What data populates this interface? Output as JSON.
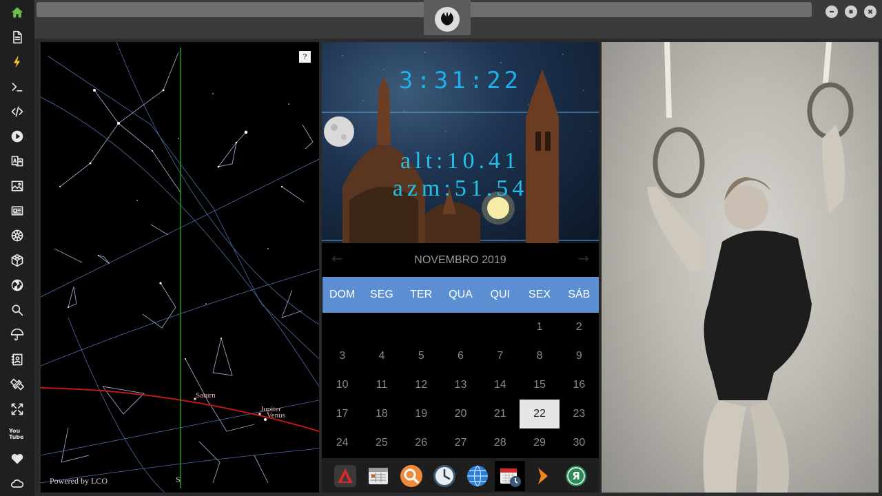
{
  "sidebar": {
    "items": [
      {
        "icon": "home-icon",
        "active_color": "#6abf4b"
      },
      {
        "icon": "document-icon"
      },
      {
        "icon": "lightning-icon",
        "active_color": "#f1c232"
      },
      {
        "icon": "terminal-icon"
      },
      {
        "icon": "code-icon"
      },
      {
        "icon": "play-icon"
      },
      {
        "icon": "translate-icon"
      },
      {
        "icon": "image-icon"
      },
      {
        "icon": "news-icon"
      },
      {
        "icon": "galactic-empire-icon"
      },
      {
        "icon": "hexagon-icon"
      },
      {
        "icon": "globe-icon"
      },
      {
        "icon": "search-icon"
      },
      {
        "icon": "umbrella-icon"
      },
      {
        "icon": "contacts-icon"
      },
      {
        "icon": "link-icon"
      },
      {
        "icon": "expand-icon"
      },
      {
        "icon": "youtube-icon",
        "label": "You Tube"
      },
      {
        "icon": "heart-icon"
      },
      {
        "icon": "cloud-icon"
      }
    ]
  },
  "sky": {
    "help": "?",
    "credit": "Powered by LCO",
    "direction": "S",
    "planets": [
      "Saturn",
      "Jupiter",
      "Venus"
    ]
  },
  "clock": {
    "time": "3:31:22",
    "alt": "alt:10.41",
    "azm": "azm:51.54"
  },
  "calendar": {
    "prev": "←",
    "next": "→",
    "title": "NOVEMBRO 2019",
    "weekdays": [
      "DOM",
      "SEG",
      "TER",
      "QUA",
      "QUI",
      "SEX",
      "SÁB"
    ],
    "days": [
      "",
      "",
      "",
      "",
      "",
      "1",
      "2",
      "3",
      "4",
      "5",
      "6",
      "7",
      "8",
      "9",
      "10",
      "11",
      "12",
      "13",
      "14",
      "15",
      "16",
      "17",
      "18",
      "19",
      "20",
      "21",
      "22",
      "23",
      "24",
      "25",
      "26",
      "27",
      "28",
      "29",
      "30"
    ],
    "today": "22",
    "header_color": "#5b8fd1"
  },
  "dock": {
    "items": [
      {
        "icon": "red-triangle-app-icon"
      },
      {
        "icon": "calendar-table-app-icon"
      },
      {
        "icon": "search-app-icon"
      },
      {
        "icon": "clock-app-icon"
      },
      {
        "icon": "globe-app-icon"
      },
      {
        "icon": "calendar-clock-app-icon",
        "active": true
      },
      {
        "icon": "chevron-app-icon"
      },
      {
        "icon": "yandex-app-icon",
        "label": "Я"
      }
    ]
  }
}
